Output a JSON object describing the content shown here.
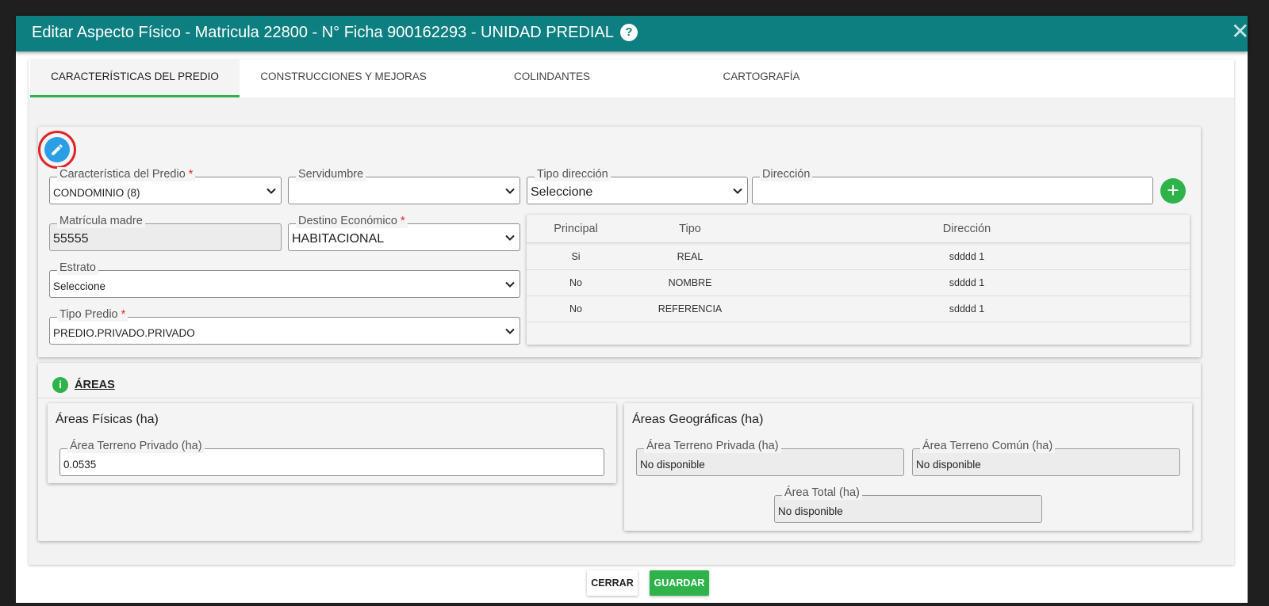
{
  "modal": {
    "title": "Editar Aspecto Físico - Matricula 22800 - N° Ficha 900162293 - UNIDAD PREDIAL",
    "help_glyph": "?",
    "close_glyph": "✕"
  },
  "tabs": [
    {
      "label": "CARACTERÍSTICAS DEL PREDIO",
      "active": true
    },
    {
      "label": "CONSTRUCCIONES Y MEJORAS",
      "active": false
    },
    {
      "label": "COLINDANTES",
      "active": false
    },
    {
      "label": "CARTOGRAFÍA",
      "active": false
    }
  ],
  "form": {
    "caracteristica": {
      "label": "Característica del Predio",
      "required_mark": "*",
      "value": "CONDOMINIO (8)"
    },
    "servidumbre": {
      "label": "Servidumbre",
      "value": ""
    },
    "tipo_direccion": {
      "label": "Tipo dirección",
      "value": "Seleccione"
    },
    "direccion": {
      "label": "Dirección",
      "value": ""
    },
    "matricula_madre": {
      "label": "Matrícula madre",
      "value": "55555"
    },
    "destino": {
      "label": "Destino Económico",
      "required_mark": "*",
      "value": "HABITACIONAL"
    },
    "estrato": {
      "label": "Estrato",
      "value": "Seleccione"
    },
    "tipo_predio": {
      "label": "Tipo Predio",
      "required_mark": "*",
      "value": "PREDIO.PRIVADO.PRIVADO"
    },
    "add_glyph": "+"
  },
  "address_table": {
    "headers": [
      "Principal",
      "Tipo",
      "Dirección"
    ],
    "rows": [
      [
        "Si",
        "REAL",
        "sdddd 1"
      ],
      [
        "No",
        "NOMBRE",
        "sdddd 1"
      ],
      [
        "No",
        "REFERENCIA",
        "sdddd 1"
      ]
    ]
  },
  "areas": {
    "info_glyph": "i",
    "title": "ÁREAS",
    "fisicas": {
      "title": "Áreas Físicas (ha)",
      "terreno_privado": {
        "label": "Área Terreno Privado (ha)",
        "value": "0.0535"
      }
    },
    "geograficas": {
      "title": "Áreas Geográficas (ha)",
      "terreno_privada": {
        "label": "Área Terreno Privada (ha)",
        "value": "No disponible"
      },
      "terreno_comun": {
        "label": "Área Terreno Común (ha)",
        "value": "No disponible"
      },
      "total": {
        "label": "Área Total (ha)",
        "value": "No disponible"
      }
    }
  },
  "footer": {
    "close_label": "CERRAR",
    "save_label": "GUARDAR"
  },
  "colors": {
    "header": "#0e7f80",
    "accent": "#2db34a",
    "edit_button": "#2b9fe6",
    "required": "#e02525"
  }
}
